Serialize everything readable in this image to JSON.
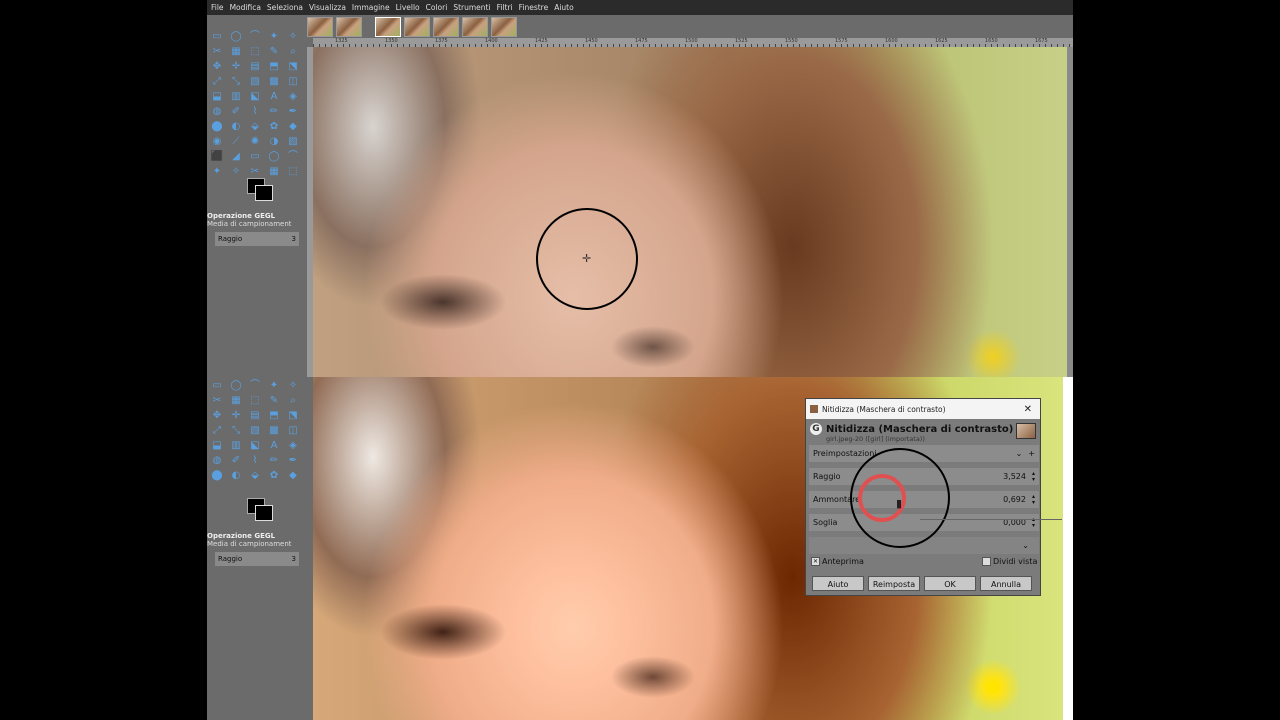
{
  "menu": [
    "File",
    "Modifica",
    "Seleziona",
    "Visualizza",
    "Immagine",
    "Livello",
    "Colori",
    "Strumenti",
    "Filtri",
    "Finestre",
    "Aiuto"
  ],
  "ruler_ticks": [
    "1325",
    "1350",
    "1375",
    "1400",
    "1425",
    "1450",
    "1475",
    "1500",
    "1525",
    "1550",
    "1575",
    "1600",
    "1625",
    "1650",
    "1675"
  ],
  "tool_options": {
    "title": "Operazione GEGL",
    "sub": "Media di campionament",
    "field_label": "Raggio",
    "field_value": "3"
  },
  "dialog": {
    "window_title": "Nitidizza (Maschera di contrasto)",
    "heading": "Nitidizza (Maschera di contrasto)",
    "subheading": "girl.jpeg-20 ([girl] (importata))",
    "presets_label": "Preimpostazioni",
    "radius_label": "Raggio",
    "radius_value": "3,524",
    "amount_label": "Ammontare",
    "amount_value": "0,692",
    "threshold_label": "Soglia",
    "threshold_value": "0,000",
    "preview_label": "Anteprima",
    "split_label": "Dividi vista",
    "buttons": {
      "help": "Aiuto",
      "reset": "Reimposta",
      "ok": "OK",
      "cancel": "Annulla"
    }
  }
}
